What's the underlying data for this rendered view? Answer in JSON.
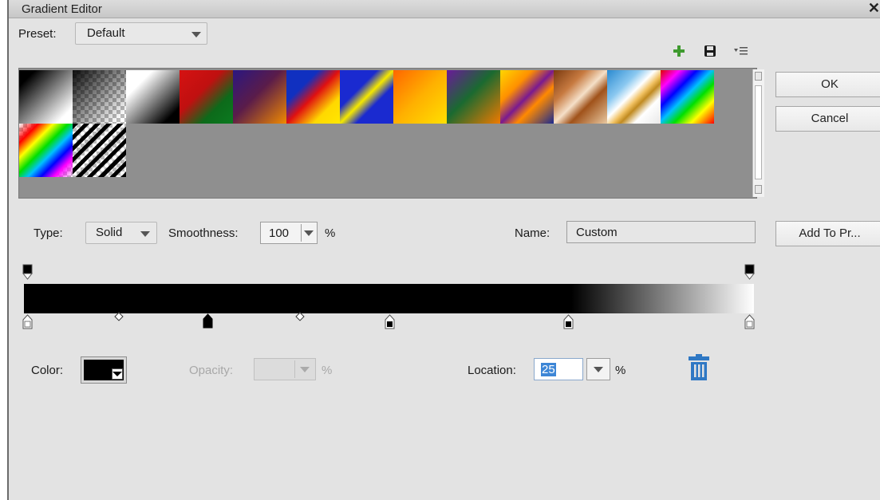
{
  "window": {
    "title": "Gradient Editor",
    "close_glyph": "✕"
  },
  "preset": {
    "label": "Preset:",
    "value": "Default",
    "icons": [
      "plus-icon",
      "save-icon",
      "menu-icon"
    ]
  },
  "presets": {
    "count": 15
  },
  "buttons": {
    "ok": "OK",
    "cancel": "Cancel",
    "add_to_preset": "Add To Pr..."
  },
  "type": {
    "label": "Type:",
    "value": "Solid"
  },
  "smoothness": {
    "label": "Smoothness:",
    "value": "100",
    "unit": "%"
  },
  "name": {
    "label": "Name:",
    "value": "Custom"
  },
  "stops": {
    "color": {
      "label": "Color:",
      "value_hex": "#000000"
    },
    "opacity": {
      "label": "Opacity:",
      "unit": "%"
    },
    "location": {
      "label": "Location:",
      "value": "25",
      "unit": "%"
    }
  },
  "colors": {
    "dialog_bg": "#e3e3e3",
    "preset_bg": "#8f8f8f",
    "accent_blue": "#3d86d6",
    "trash_blue": "#2f78c4"
  }
}
